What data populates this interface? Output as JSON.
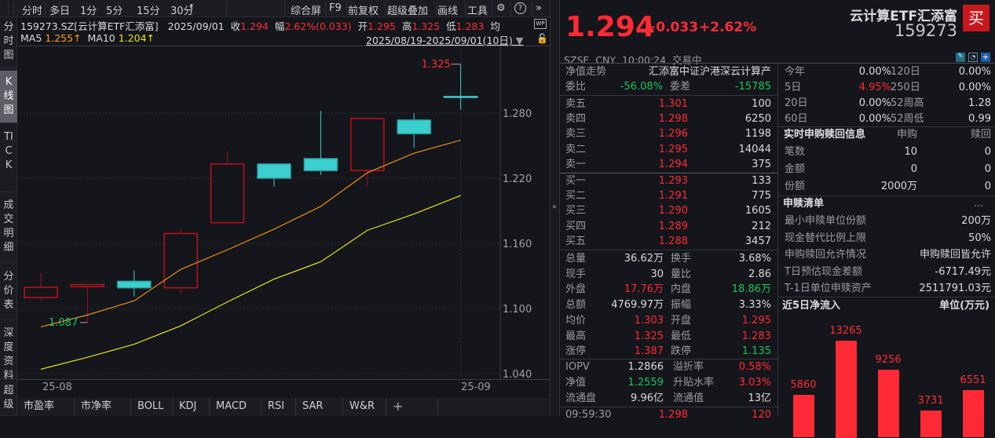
{
  "toolbar": {
    "left": [
      "分时",
      "多日",
      "1分",
      "5分",
      "15分",
      "30分"
    ],
    "more": "▾",
    "right": [
      "综合屏",
      "F9",
      "前复权",
      "超级叠加",
      "画线",
      "工具"
    ],
    "gear": "⚙",
    "help": "?",
    "expand": "»"
  },
  "sidebar": [
    "分时图",
    "K线图",
    "TICK",
    "成交明细",
    "分价表",
    "深度资料",
    "超级"
  ],
  "info": {
    "symbol": "159273.SZ[云计算ETF汇添富]",
    "date": "2025/09/01",
    "close_label": "收",
    "close": "1.294",
    "chg_label": "幅",
    "chg": "2.62%(0.033)",
    "open_label": "开",
    "open": "1.295",
    "high_label": "高",
    "high": "1.325",
    "low_label": "低",
    "low": "1.283",
    "avg_label": "均",
    "ma5_label": "MA5",
    "ma5": "1.255↑",
    "ma10_label": "MA10",
    "ma10": "1.204↑",
    "range": "2025/08/19-2025/09/01(10日)"
  },
  "chart_data": {
    "type": "candlestick",
    "y_ticks": [
      "1.280",
      "1.220",
      "1.160",
      "1.100",
      "1.040"
    ],
    "y_tick_values": [
      1.28,
      1.22,
      1.16,
      1.1,
      1.04
    ],
    "x_labels": [
      "25-08",
      "25-09"
    ],
    "candles": [
      {
        "o": 1.11,
        "h": 1.1325,
        "l": 1.107,
        "c": 1.1195
      },
      {
        "o": 1.12,
        "h": 1.122,
        "l": 1.087,
        "c": 1.122
      },
      {
        "o": 1.125,
        "h": 1.135,
        "l": 1.111,
        "c": 1.119
      },
      {
        "o": 1.119,
        "h": 1.173,
        "l": 1.113,
        "c": 1.169
      },
      {
        "o": 1.179,
        "h": 1.245,
        "l": 1.179,
        "c": 1.233
      },
      {
        "o": 1.233,
        "h": 1.233,
        "l": 1.212,
        "c": 1.22
      },
      {
        "o": 1.238,
        "h": 1.282,
        "l": 1.223,
        "c": 1.227
      },
      {
        "o": 1.227,
        "h": 1.275,
        "l": 1.213,
        "c": 1.275
      },
      {
        "o": 1.2735,
        "h": 1.28,
        "l": 1.248,
        "c": 1.261
      },
      {
        "o": 1.295,
        "h": 1.325,
        "l": 1.283,
        "c": 1.294
      }
    ],
    "ma5": [
      1.083,
      1.094,
      1.107,
      1.136,
      1.154,
      1.173,
      1.194,
      1.225,
      1.243,
      1.255
    ],
    "ma10": [
      1.044,
      1.055,
      1.067,
      1.084,
      1.106,
      1.127,
      1.143,
      1.172,
      1.187,
      1.204
    ],
    "annotations": {
      "max": "1.325",
      "min": "1.087"
    }
  },
  "tabs": [
    "市盈率",
    "市净率",
    "BOLL",
    "KDJ",
    "MACD",
    "RSI",
    "SAR",
    "W&R",
    "+"
  ],
  "quote": {
    "price": "1.294",
    "change": "+0.033",
    "pct": "+2.62%",
    "name": "云计算ETF汇添富",
    "code": "159273",
    "buy": "买",
    "status": "SZSE  CNY  10:00:24  交易中"
  },
  "book": {
    "nav_trend": "净值走势",
    "fund_name": "汇添富中证沪港深云计算产",
    "wb_label": "委比",
    "wb": "-56.08%",
    "wc_label": "委差",
    "wc": "-15785",
    "asks": [
      [
        "卖五",
        "1.301",
        "100"
      ],
      [
        "卖四",
        "1.298",
        "6250"
      ],
      [
        "卖三",
        "1.296",
        "1198"
      ],
      [
        "卖二",
        "1.295",
        "14044"
      ],
      [
        "卖一",
        "1.294",
        "375"
      ]
    ],
    "bids": [
      [
        "买一",
        "1.293",
        "133"
      ],
      [
        "买二",
        "1.291",
        "775"
      ],
      [
        "买三",
        "1.290",
        "1605"
      ],
      [
        "买四",
        "1.289",
        "212"
      ],
      [
        "买五",
        "1.288",
        "3457"
      ]
    ]
  },
  "stats": [
    [
      "总量",
      "36.62万",
      "white",
      "换手",
      "3.68%",
      "white"
    ],
    [
      "现手",
      "30",
      "white",
      "量比",
      "2.86",
      "white"
    ],
    [
      "外盘",
      "17.76万",
      "red",
      "内盘",
      "18.86万",
      "green"
    ],
    [
      "总额",
      "4769.97万",
      "white",
      "振幅",
      "3.33%",
      "white"
    ],
    [
      "均价",
      "1.303",
      "red",
      "开盘",
      "1.295",
      "red"
    ],
    [
      "最高",
      "1.325",
      "red",
      "最低",
      "1.283",
      "red"
    ],
    [
      "涨停",
      "1.387",
      "red",
      "跌停",
      "1.135",
      "green"
    ]
  ],
  "etf": [
    [
      "IOPV",
      "1.2866",
      "white",
      "溢折率",
      "0.58%",
      "red"
    ],
    [
      "净值",
      "1.2559",
      "green",
      "升贴水率",
      "3.03%",
      "red"
    ],
    [
      "流通盘",
      "9.96亿",
      "white",
      "流通值",
      "13亿",
      "white"
    ]
  ],
  "tick": [
    "09:59:30",
    "1.298",
    "120"
  ],
  "perf": [
    [
      "今年",
      "0.00%",
      "white",
      "120日",
      "0.00%"
    ],
    [
      "5日",
      "4.95%",
      "red",
      "250日",
      "0.00%"
    ],
    [
      "20日",
      "0.00%",
      "white",
      "52周高",
      "1.28"
    ],
    [
      "60日",
      "0.00%",
      "white",
      "52周低",
      "0.99"
    ]
  ],
  "creation": {
    "title": "实时申购赎回信息",
    "col1": "申购",
    "col2": "赎回",
    "rows": [
      [
        "笔数",
        "10",
        "0"
      ],
      [
        "金额",
        "0",
        "0"
      ],
      [
        "份额",
        "2000万",
        "0"
      ]
    ]
  },
  "list": {
    "title": "申赎清单",
    "more": "...",
    "rows": [
      [
        "最小申赎单位份额",
        "200万"
      ],
      [
        "现金替代比例上限",
        "50%"
      ],
      [
        "申购赎回允许情况",
        "申购赎回皆允许"
      ],
      [
        "T日预估现金差额",
        "-6717.49元"
      ],
      [
        "T-1日单位申赎资产",
        "2511791.03元"
      ]
    ]
  },
  "flow": {
    "title": "近5日净流入",
    "unit": "单位(万元)",
    "values": [
      5860,
      13265,
      9256,
      3731,
      6551
    ],
    "labels": [
      "5860",
      "13265",
      "9256",
      "3731",
      "6551"
    ]
  },
  "colors": {
    "up": "#ff2a36",
    "down": "#3ccfcf",
    "ma5": "#e8901a",
    "ma10": "#e8e020",
    "bg": "#14161b"
  }
}
